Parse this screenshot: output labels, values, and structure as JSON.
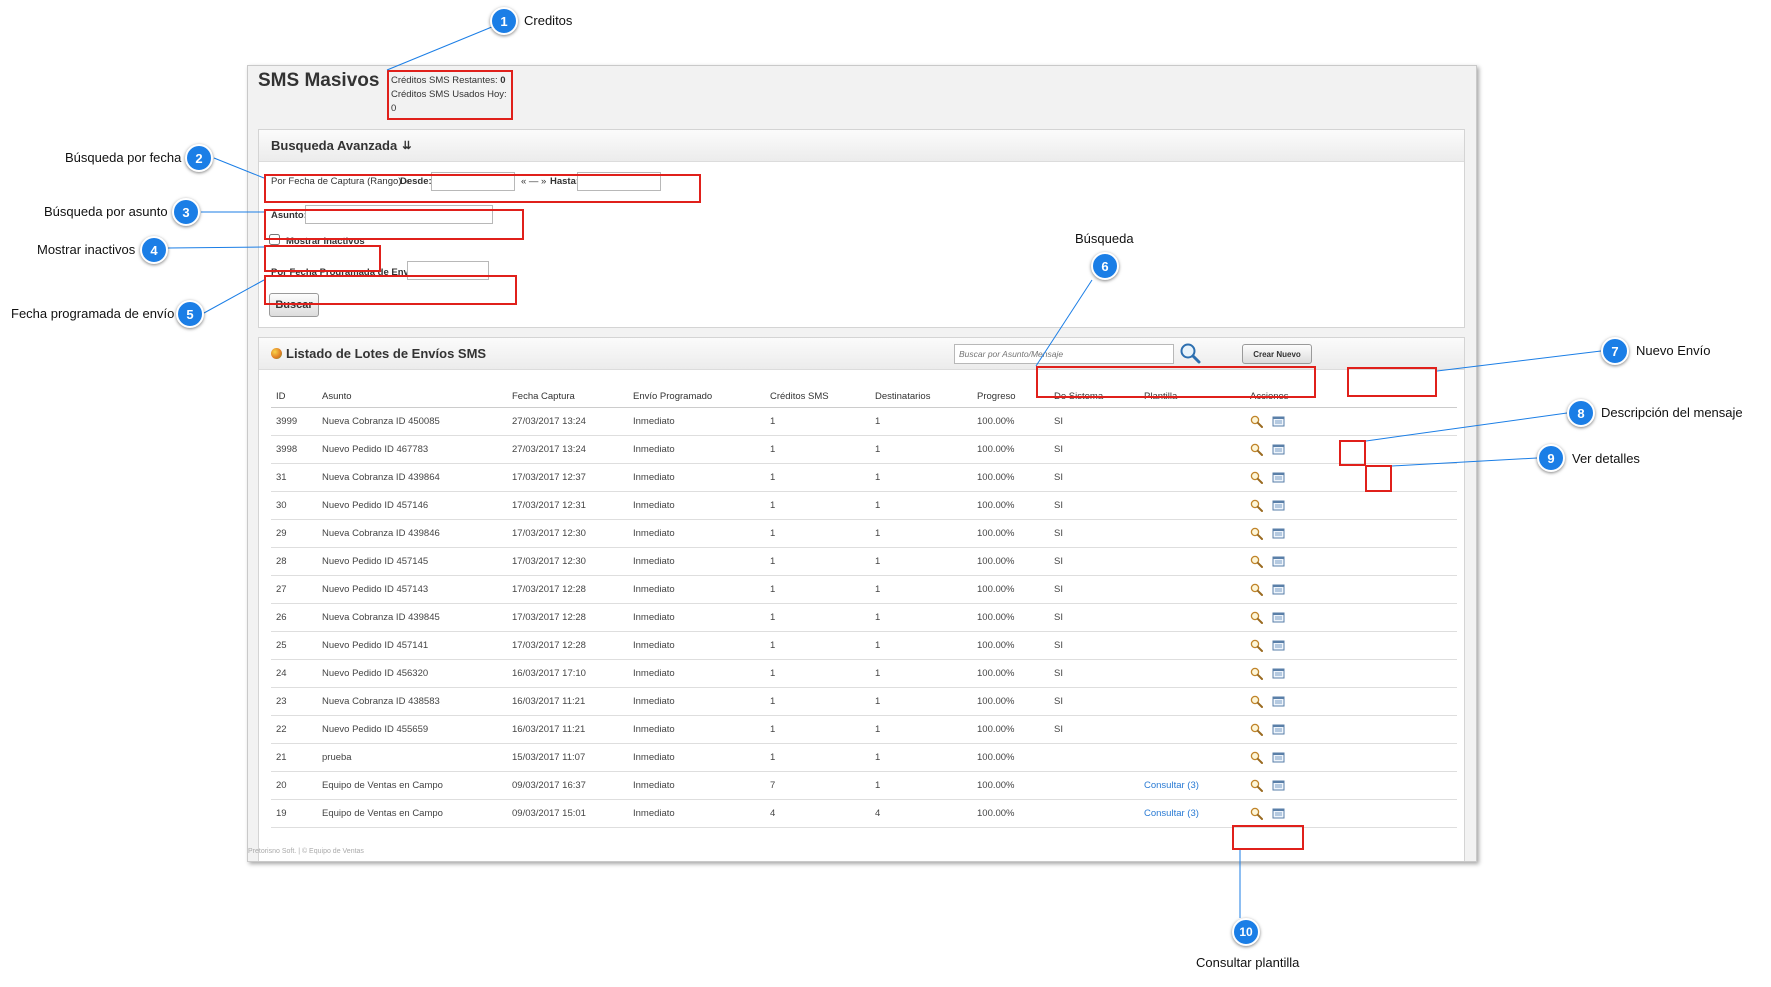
{
  "annotations": [
    {
      "num": "1",
      "label": "Creditos"
    },
    {
      "num": "2",
      "label": "Búsqueda por fecha"
    },
    {
      "num": "3",
      "label": "Búsqueda por asunto"
    },
    {
      "num": "4",
      "label": "Mostrar inactivos"
    },
    {
      "num": "5",
      "label": "Fecha programada de envío"
    },
    {
      "num": "6",
      "label": "Búsqueda"
    },
    {
      "num": "7",
      "label": "Nuevo Envío"
    },
    {
      "num": "8",
      "label": "Descripción del mensaje"
    },
    {
      "num": "9",
      "label": "Ver detalles"
    },
    {
      "num": "10",
      "label": "Consultar plantilla"
    }
  ],
  "app": {
    "title": "SMS Masivos",
    "credits_remaining_label": "Créditos SMS Restantes:",
    "credits_remaining_value": "0",
    "credits_used_label": "Créditos SMS Usados Hoy:",
    "credits_used_value": "0"
  },
  "search": {
    "title": "Busqueda Avanzada",
    "title_icon": "double-down-arrow-icon",
    "date_range_label": "Por Fecha de Captura (Rango) »",
    "from_label": "Desde:",
    "from_value": "",
    "range_sep": "« — »",
    "to_label": "Hasta:",
    "to_value": "",
    "subject_label": "Asunto:",
    "subject_value": "",
    "inactive_label": "Mostrar Inactivos",
    "inactive_checked": false,
    "scheduled_label": "Por Fecha Programada de Envío:",
    "scheduled_value": "",
    "search_button": "Buscar"
  },
  "list": {
    "title": "Listado de Lotes de Envíos SMS",
    "title_icon": "sms-batch-icon",
    "search_placeholder": "Buscar por Asunto/Mensaje",
    "search_icon": "magnifier-icon",
    "new_button": "Crear Nuevo",
    "columns": [
      "ID",
      "Asunto",
      "Fecha Captura",
      "Envío Programado",
      "Créditos SMS",
      "Destinatarios",
      "Progreso",
      "De Sistema",
      "Plantilla",
      "Acciones"
    ],
    "rows": [
      {
        "id": "3999",
        "subject": "Nueva Cobranza ID 450085",
        "date": "27/03/2017 13:24",
        "scheduled": "Inmediato",
        "credits": "1",
        "recipients": "1",
        "progress": "100.00%",
        "system": "SI",
        "template": ""
      },
      {
        "id": "3998",
        "subject": "Nuevo Pedido ID 467783",
        "date": "27/03/2017 13:24",
        "scheduled": "Inmediato",
        "credits": "1",
        "recipients": "1",
        "progress": "100.00%",
        "system": "SI",
        "template": ""
      },
      {
        "id": "31",
        "subject": "Nueva Cobranza ID 439864",
        "date": "17/03/2017 12:37",
        "scheduled": "Inmediato",
        "credits": "1",
        "recipients": "1",
        "progress": "100.00%",
        "system": "SI",
        "template": ""
      },
      {
        "id": "30",
        "subject": "Nuevo Pedido ID 457146",
        "date": "17/03/2017 12:31",
        "scheduled": "Inmediato",
        "credits": "1",
        "recipients": "1",
        "progress": "100.00%",
        "system": "SI",
        "template": ""
      },
      {
        "id": "29",
        "subject": "Nueva Cobranza ID 439846",
        "date": "17/03/2017 12:30",
        "scheduled": "Inmediato",
        "credits": "1",
        "recipients": "1",
        "progress": "100.00%",
        "system": "SI",
        "template": ""
      },
      {
        "id": "28",
        "subject": "Nuevo Pedido ID 457145",
        "date": "17/03/2017 12:30",
        "scheduled": "Inmediato",
        "credits": "1",
        "recipients": "1",
        "progress": "100.00%",
        "system": "SI",
        "template": ""
      },
      {
        "id": "27",
        "subject": "Nuevo Pedido ID 457143",
        "date": "17/03/2017 12:28",
        "scheduled": "Inmediato",
        "credits": "1",
        "recipients": "1",
        "progress": "100.00%",
        "system": "SI",
        "template": ""
      },
      {
        "id": "26",
        "subject": "Nueva Cobranza ID 439845",
        "date": "17/03/2017 12:28",
        "scheduled": "Inmediato",
        "credits": "1",
        "recipients": "1",
        "progress": "100.00%",
        "system": "SI",
        "template": ""
      },
      {
        "id": "25",
        "subject": "Nuevo Pedido ID 457141",
        "date": "17/03/2017 12:28",
        "scheduled": "Inmediato",
        "credits": "1",
        "recipients": "1",
        "progress": "100.00%",
        "system": "SI",
        "template": ""
      },
      {
        "id": "24",
        "subject": "Nuevo Pedido ID 456320",
        "date": "16/03/2017 17:10",
        "scheduled": "Inmediato",
        "credits": "1",
        "recipients": "1",
        "progress": "100.00%",
        "system": "SI",
        "template": ""
      },
      {
        "id": "23",
        "subject": "Nueva Cobranza ID 438583",
        "date": "16/03/2017 11:21",
        "scheduled": "Inmediato",
        "credits": "1",
        "recipients": "1",
        "progress": "100.00%",
        "system": "SI",
        "template": ""
      },
      {
        "id": "22",
        "subject": "Nuevo Pedido ID 455659",
        "date": "16/03/2017 11:21",
        "scheduled": "Inmediato",
        "credits": "1",
        "recipients": "1",
        "progress": "100.00%",
        "system": "SI",
        "template": ""
      },
      {
        "id": "21",
        "subject": "prueba",
        "date": "15/03/2017 11:07",
        "scheduled": "Inmediato",
        "credits": "1",
        "recipients": "1",
        "progress": "100.00%",
        "system": "",
        "template": ""
      },
      {
        "id": "20",
        "subject": "Equipo de Ventas en Campo",
        "date": "09/03/2017 16:37",
        "scheduled": "Inmediato",
        "credits": "7",
        "recipients": "1",
        "progress": "100.00%",
        "system": "",
        "template": "Consultar (3)"
      },
      {
        "id": "19",
        "subject": "Equipo de Ventas en Campo",
        "date": "09/03/2017 15:01",
        "scheduled": "Inmediato",
        "credits": "4",
        "recipients": "4",
        "progress": "100.00%",
        "system": "",
        "template": "Consultar (3)"
      }
    ]
  },
  "footer": "Pretorisno Soft. | © Equipo de Ventas",
  "colors": {
    "annotation": "#1b7ee6",
    "highlight": "#e0201b",
    "link": "#2a7bd4"
  }
}
